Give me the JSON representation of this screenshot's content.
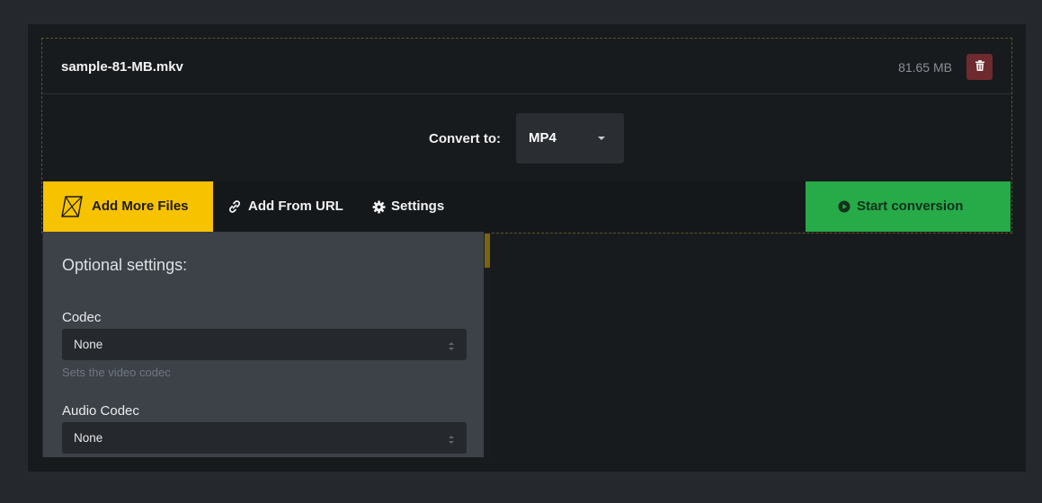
{
  "file": {
    "name": "sample-81-MB.mkv",
    "size": "81.65 MB"
  },
  "convert": {
    "label": "Convert to:",
    "format": "MP4"
  },
  "toolbar": {
    "add_files_label": "Add More Files",
    "add_url_label": "Add From URL",
    "settings_label": "Settings",
    "start_label": "Start conversion"
  },
  "optional_settings": {
    "title": "Optional settings:",
    "fields": [
      {
        "label": "Codec",
        "value": "None",
        "help": "Sets the video codec"
      },
      {
        "label": "Audio Codec",
        "value": "None"
      }
    ]
  },
  "colors": {
    "accent_yellow": "#f7c200",
    "start_green": "#27aa48",
    "delete_red": "#6e2a2e"
  },
  "icons": [
    "file-icon",
    "trash-icon",
    "link-icon",
    "gear-icon",
    "play-circle-icon",
    "select-arrows-icon"
  ]
}
